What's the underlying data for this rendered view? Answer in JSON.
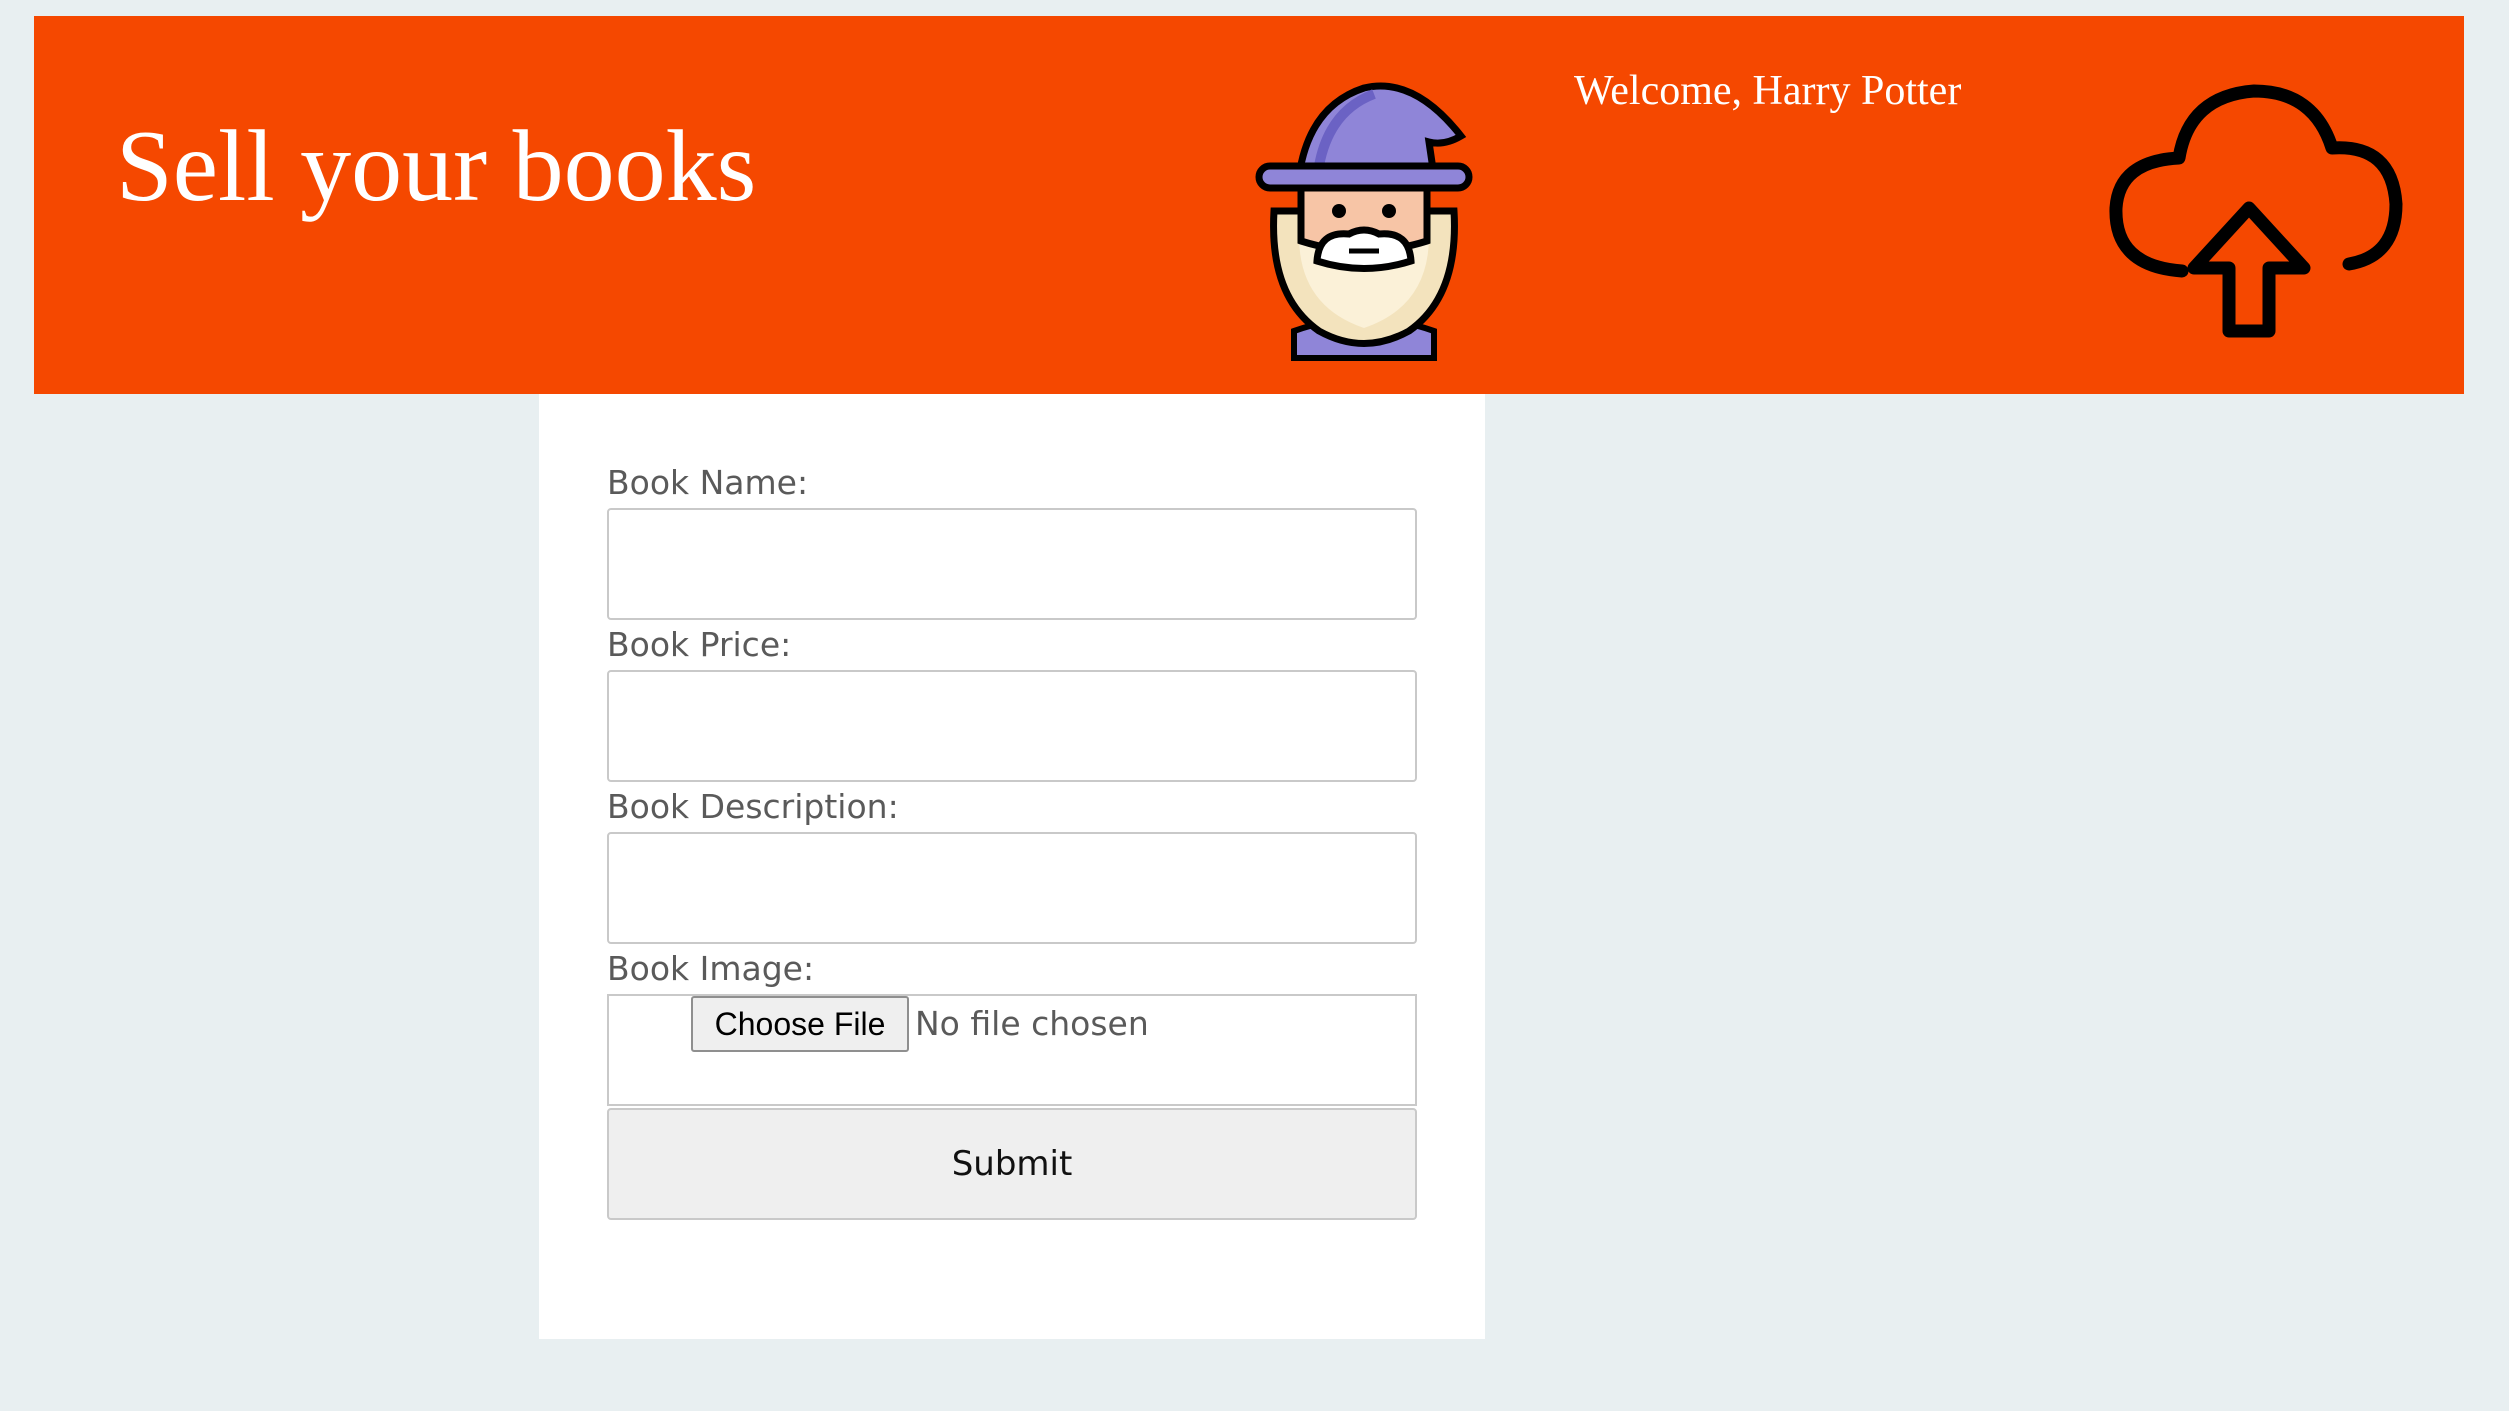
{
  "header": {
    "title": "Sell your books",
    "welcome": "Welcome, Harry Potter",
    "avatar_icon": "wizard-avatar-icon",
    "upload_icon": "cloud-upload-icon",
    "background_color": "#f54800"
  },
  "form": {
    "fields": [
      {
        "label": "Book Name:",
        "value": ""
      },
      {
        "label": "Book Price:",
        "value": ""
      },
      {
        "label": "Book Description:",
        "value": ""
      }
    ],
    "image": {
      "label": "Book Image:",
      "choose_button": "Choose File",
      "status": "No file chosen"
    },
    "submit_label": "Submit"
  }
}
